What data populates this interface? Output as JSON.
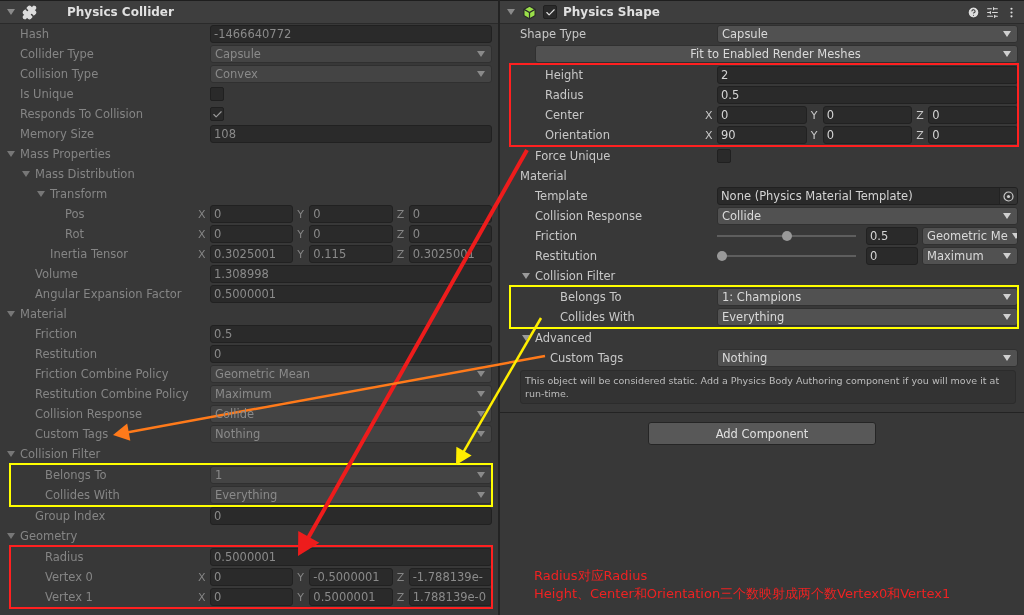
{
  "left": {
    "title": "Physics Collider",
    "expanded": true,
    "disabled": true,
    "rows": [
      {
        "kind": "field",
        "label": "Hash",
        "value": "-1466640772"
      },
      {
        "kind": "dropdown",
        "label": "Collider Type",
        "value": "Capsule"
      },
      {
        "kind": "dropdown",
        "label": "Collision Type",
        "value": "Convex"
      },
      {
        "kind": "checkbox",
        "label": "Is Unique",
        "checked": false
      },
      {
        "kind": "checkbox",
        "label": "Responds To Collision",
        "checked": true
      },
      {
        "kind": "field",
        "label": "Memory Size",
        "value": "108"
      },
      {
        "kind": "foldout",
        "label": "Mass Properties",
        "expanded": true,
        "children": [
          {
            "kind": "foldout",
            "label": "Mass Distribution",
            "expanded": true,
            "children": [
              {
                "kind": "foldout",
                "label": "Transform",
                "expanded": true,
                "children": [
                  {
                    "kind": "vector",
                    "label": "Pos",
                    "components": [
                      {
                        "axis": "X",
                        "value": "0"
                      },
                      {
                        "axis": "Y",
                        "value": "0"
                      },
                      {
                        "axis": "Z",
                        "value": "0"
                      }
                    ]
                  },
                  {
                    "kind": "vector",
                    "label": "Rot",
                    "components": [
                      {
                        "axis": "X",
                        "value": "0"
                      },
                      {
                        "axis": "Y",
                        "value": "0"
                      },
                      {
                        "axis": "Z",
                        "value": "0"
                      }
                    ]
                  }
                ]
              },
              {
                "kind": "vector",
                "label": "Inertia Tensor",
                "components": [
                  {
                    "axis": "X",
                    "value": "0.3025001"
                  },
                  {
                    "axis": "Y",
                    "value": "0.115"
                  },
                  {
                    "axis": "Z",
                    "value": "0.3025001"
                  }
                ]
              }
            ]
          },
          {
            "kind": "field",
            "label": "Volume",
            "value": "1.308998"
          },
          {
            "kind": "field",
            "label": "Angular Expansion Factor",
            "value": "0.5000001"
          }
        ]
      },
      {
        "kind": "foldout",
        "label": "Material",
        "expanded": true,
        "children": [
          {
            "kind": "field",
            "label": "Friction",
            "value": "0.5"
          },
          {
            "kind": "field",
            "label": "Restitution",
            "value": "0"
          },
          {
            "kind": "dropdown",
            "label": "Friction Combine Policy",
            "value": "Geometric Mean"
          },
          {
            "kind": "dropdown",
            "label": "Restitution Combine Policy",
            "value": "Maximum"
          },
          {
            "kind": "dropdown",
            "label": "Collision Response",
            "value": "Collide"
          },
          {
            "kind": "dropdown",
            "label": "Custom Tags",
            "value": "Nothing"
          }
        ]
      },
      {
        "kind": "foldout",
        "label": "Collision Filter",
        "expanded": true,
        "children": [
          {
            "kind": "highlight",
            "color": "#ffff00",
            "children": [
              {
                "kind": "dropdown",
                "label": "Belongs To",
                "value": "1"
              },
              {
                "kind": "dropdown",
                "label": "Collides With",
                "value": "Everything"
              }
            ]
          },
          {
            "kind": "field",
            "label": "Group Index",
            "value": "0"
          }
        ]
      },
      {
        "kind": "foldout",
        "label": "Geometry",
        "expanded": true,
        "children": [
          {
            "kind": "highlight",
            "color": "#ff2020",
            "children": [
              {
                "kind": "field",
                "label": "Radius",
                "value": "0.5000001"
              },
              {
                "kind": "vector",
                "label": "Vertex 0",
                "components": [
                  {
                    "axis": "X",
                    "value": "0"
                  },
                  {
                    "axis": "Y",
                    "value": "-0.5000001"
                  },
                  {
                    "axis": "Z",
                    "value": "-1.788139e-"
                  }
                ]
              },
              {
                "kind": "vector",
                "label": "Vertex 1",
                "components": [
                  {
                    "axis": "X",
                    "value": "0"
                  },
                  {
                    "axis": "Y",
                    "value": "0.5000001"
                  },
                  {
                    "axis": "Z",
                    "value": "1.788139e-0"
                  }
                ]
              }
            ]
          }
        ]
      }
    ]
  },
  "right": {
    "title": "Physics Shape",
    "expanded": true,
    "enabled": true,
    "disabled": false,
    "rows": [
      {
        "kind": "dropdown",
        "label": "Shape Type",
        "value": "Capsule",
        "children": [
          {
            "kind": "wide-dropdown",
            "value": "Fit to Enabled Render Meshes"
          },
          {
            "kind": "highlight",
            "color": "#ff2020",
            "children": [
              {
                "kind": "field",
                "label": "Height",
                "value": "2"
              },
              {
                "kind": "field",
                "label": "Radius",
                "value": "0.5"
              },
              {
                "kind": "vector",
                "label": "Center",
                "components": [
                  {
                    "axis": "X",
                    "value": "0"
                  },
                  {
                    "axis": "Y",
                    "value": "0"
                  },
                  {
                    "axis": "Z",
                    "value": "0"
                  }
                ]
              },
              {
                "kind": "vector",
                "label": "Orientation",
                "components": [
                  {
                    "axis": "X",
                    "value": "90"
                  },
                  {
                    "axis": "Y",
                    "value": "0"
                  },
                  {
                    "axis": "Z",
                    "value": "0"
                  }
                ]
              }
            ]
          },
          {
            "kind": "checkbox",
            "label": "Force Unique",
            "checked": false
          }
        ]
      },
      {
        "kind": "section",
        "label": "Material",
        "children": [
          {
            "kind": "object",
            "label": "Template",
            "value": "None (Physics Material Template)"
          },
          {
            "kind": "dropdown",
            "label": "Collision Response",
            "value": "Collide"
          },
          {
            "kind": "slider",
            "label": "Friction",
            "level": 0.5,
            "value": "0.5",
            "mode": "Geometric Me"
          },
          {
            "kind": "slider",
            "label": "Restitution",
            "level": 0,
            "value": "0",
            "mode": "Maximum"
          },
          {
            "kind": "foldout",
            "label": "Collision Filter",
            "expanded": true,
            "children": [
              {
                "kind": "highlight",
                "color": "#ffff00",
                "children": [
                  {
                    "kind": "dropdown",
                    "label": "Belongs To",
                    "value": "1: Champions"
                  },
                  {
                    "kind": "dropdown",
                    "label": "Collides With",
                    "value": "Everything"
                  }
                ]
              }
            ]
          },
          {
            "kind": "foldout",
            "label": "Advanced",
            "expanded": true,
            "children": [
              {
                "kind": "dropdown",
                "label": "Custom Tags",
                "value": "Nothing"
              }
            ]
          }
        ]
      }
    ],
    "help": "This object will be considered static. Add a Physics Body Authoring component if you will move it at run-time.",
    "add_button": "Add Component"
  },
  "annotation": [
    "Radius对应Radius",
    "Height、Center和Orientation三个数映射成两个数Vertex0和Vertex1"
  ]
}
